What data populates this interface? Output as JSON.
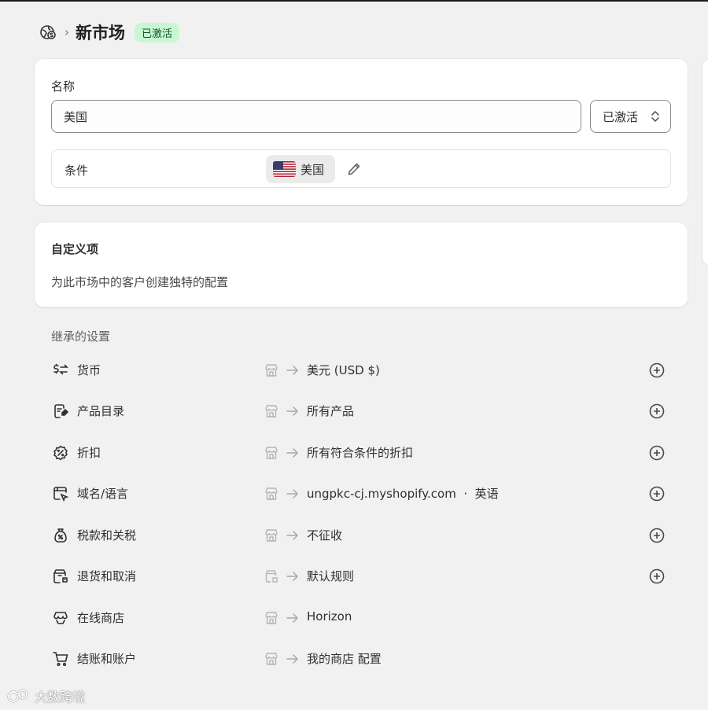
{
  "header": {
    "title": "新市场",
    "status_badge": "已激活"
  },
  "main_card": {
    "name_label": "名称",
    "name_value": "美国",
    "status_select": "已激活",
    "condition_label": "条件",
    "condition_country": "美国"
  },
  "custom_card": {
    "title": "自定义项",
    "description": "为此市场中的客户创建独特的配置"
  },
  "inherited": {
    "title": "继承的设置",
    "rows": [
      {
        "label": "货币",
        "value": "美元 (USD $)",
        "icon": "currency-icon"
      },
      {
        "label": "产品目录",
        "value": "所有产品",
        "icon": "catalog-icon"
      },
      {
        "label": "折扣",
        "value": "所有符合条件的折扣",
        "icon": "discount-icon"
      },
      {
        "label": "域名/语言",
        "value": "ungpkc-cj.myshopify.com  ·  英语",
        "icon": "domain-icon"
      },
      {
        "label": "税款和关税",
        "value": "不征收",
        "icon": "tax-icon"
      },
      {
        "label": "退货和取消",
        "value": "默认规则",
        "icon": "returns-icon"
      },
      {
        "label": "在线商店",
        "value": "Horizon",
        "icon": "online-store-icon"
      },
      {
        "label": "结账和账户",
        "value": "我的商店 配置",
        "icon": "cart-icon"
      }
    ]
  },
  "watermark": "大数跨境",
  "colors": {
    "badge_bg": "#c9f7d2",
    "badge_text": "#0c5132",
    "page_bg": "#f1f1f1"
  }
}
